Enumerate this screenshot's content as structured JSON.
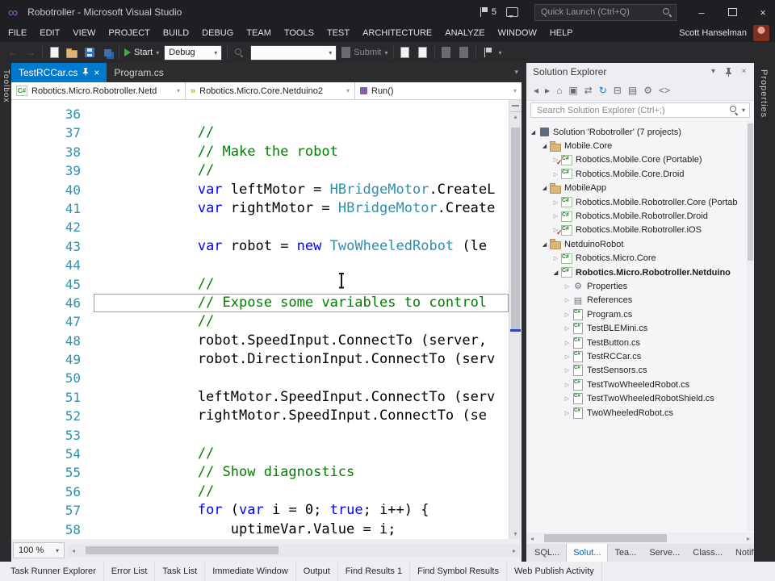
{
  "window": {
    "title": "Robotroller - Microsoft Visual Studio",
    "notification_count": "5",
    "quick_launch_placeholder": "Quick Launch (Ctrl+Q)",
    "user_name": "Scott Hanselman"
  },
  "menus": [
    "FILE",
    "EDIT",
    "VIEW",
    "PROJECT",
    "BUILD",
    "DEBUG",
    "TEAM",
    "TOOLS",
    "TEST",
    "ARCHITECTURE",
    "ANALYZE",
    "WINDOW",
    "HELP"
  ],
  "toolbar": {
    "start_label": "Start",
    "debug_value": "Debug",
    "submit_label": "Submit"
  },
  "side_strips": {
    "left_label": "Toolbox",
    "right_label": "Properties"
  },
  "doc_tabs": [
    {
      "label": "TestRCCar.cs",
      "active": true
    },
    {
      "label": "Program.cs",
      "active": false
    }
  ],
  "navbar": {
    "project": "Robotics.Micro.Robotroller.Netd",
    "type": "Robotics.Micro.Core.Netduino2",
    "member": "Run()"
  },
  "editor": {
    "zoom": "100 %",
    "lines": [
      {
        "n": "36",
        "segs": []
      },
      {
        "n": "37",
        "segs": [
          {
            "t": "            //",
            "c": "com"
          }
        ]
      },
      {
        "n": "38",
        "segs": [
          {
            "t": "            // Make the robot",
            "c": "com"
          }
        ]
      },
      {
        "n": "39",
        "segs": [
          {
            "t": "            //",
            "c": "com"
          }
        ]
      },
      {
        "n": "40",
        "segs": [
          {
            "t": "            ",
            "c": "pln"
          },
          {
            "t": "var",
            "c": "kw"
          },
          {
            "t": " leftMotor = ",
            "c": "pln"
          },
          {
            "t": "HBridgeMotor",
            "c": "typ"
          },
          {
            "t": ".CreateL",
            "c": "pln"
          }
        ]
      },
      {
        "n": "41",
        "segs": [
          {
            "t": "            ",
            "c": "pln"
          },
          {
            "t": "var",
            "c": "kw"
          },
          {
            "t": " rightMotor = ",
            "c": "pln"
          },
          {
            "t": "HBridgeMotor",
            "c": "typ"
          },
          {
            "t": ".Create",
            "c": "pln"
          }
        ]
      },
      {
        "n": "42",
        "segs": []
      },
      {
        "n": "43",
        "segs": [
          {
            "t": "            ",
            "c": "pln"
          },
          {
            "t": "var",
            "c": "kw"
          },
          {
            "t": " robot = ",
            "c": "pln"
          },
          {
            "t": "new",
            "c": "kw"
          },
          {
            "t": " ",
            "c": "pln"
          },
          {
            "t": "TwoWheeledRobot",
            "c": "typ"
          },
          {
            "t": " (le",
            "c": "pln"
          }
        ]
      },
      {
        "n": "44",
        "segs": []
      },
      {
        "n": "45",
        "segs": [
          {
            "t": "            //",
            "c": "com"
          }
        ]
      },
      {
        "n": "46",
        "boxed": true,
        "segs": [
          {
            "t": "            // Expose some variables to control",
            "c": "com"
          }
        ]
      },
      {
        "n": "47",
        "segs": [
          {
            "t": "            //",
            "c": "com"
          }
        ]
      },
      {
        "n": "48",
        "segs": [
          {
            "t": "            robot.SpeedInput.ConnectTo (server,",
            "c": "pln"
          }
        ]
      },
      {
        "n": "49",
        "segs": [
          {
            "t": "            robot.DirectionInput.ConnectTo (serv",
            "c": "pln"
          }
        ]
      },
      {
        "n": "50",
        "segs": []
      },
      {
        "n": "51",
        "segs": [
          {
            "t": "            leftMotor.SpeedInput.ConnectTo (serv",
            "c": "pln"
          }
        ]
      },
      {
        "n": "52",
        "segs": [
          {
            "t": "            rightMotor.SpeedInput.ConnectTo (se",
            "c": "pln"
          }
        ]
      },
      {
        "n": "53",
        "segs": []
      },
      {
        "n": "54",
        "segs": [
          {
            "t": "            //",
            "c": "com"
          }
        ]
      },
      {
        "n": "55",
        "segs": [
          {
            "t": "            // Show diagnostics",
            "c": "com"
          }
        ]
      },
      {
        "n": "56",
        "segs": [
          {
            "t": "            //",
            "c": "com"
          }
        ]
      },
      {
        "n": "57",
        "segs": [
          {
            "t": "            ",
            "c": "pln"
          },
          {
            "t": "for",
            "c": "kw"
          },
          {
            "t": " (",
            "c": "pln"
          },
          {
            "t": "var",
            "c": "kw"
          },
          {
            "t": " i = 0; ",
            "c": "pln"
          },
          {
            "t": "true",
            "c": "kw"
          },
          {
            "t": "; i++) {",
            "c": "pln"
          }
        ]
      },
      {
        "n": "58",
        "segs": [
          {
            "t": "                uptimeVar.Value = i;",
            "c": "pln"
          }
        ]
      }
    ]
  },
  "solution_explorer": {
    "title": "Solution Explorer",
    "search_placeholder": "Search Solution Explorer (Ctrl+;)",
    "toolbar_icons": [
      "back-icon",
      "forward-icon",
      "home-icon",
      "scope-to-this-icon",
      "sync-with-active-document-icon",
      "refresh-icon",
      "collapse-all-icon",
      "show-all-files-icon",
      "properties-icon",
      "view-code-icon"
    ],
    "tree": [
      {
        "indent": 0,
        "arrow": "exp",
        "icon": "solution",
        "label": "Solution 'Robotroller' (7 projects)"
      },
      {
        "indent": 1,
        "arrow": "exp",
        "icon": "folder",
        "label": "Mobile.Core"
      },
      {
        "indent": 2,
        "arrow": "col",
        "icon": "csproj",
        "mark": true,
        "label": "Robotics.Mobile.Core (Portable)"
      },
      {
        "indent": 2,
        "arrow": "col",
        "icon": "csproj",
        "label": "Robotics.Mobile.Core.Droid"
      },
      {
        "indent": 1,
        "arrow": "exp",
        "icon": "folder",
        "label": "MobileApp"
      },
      {
        "indent": 2,
        "arrow": "col",
        "icon": "csproj",
        "label": "Robotics.Mobile.Robotroller.Core (Portab"
      },
      {
        "indent": 2,
        "arrow": "col",
        "icon": "csproj",
        "label": "Robotics.Mobile.Robotroller.Droid"
      },
      {
        "indent": 2,
        "arrow": "col",
        "icon": "csproj",
        "mark": true,
        "label": "Robotics.Mobile.Robotroller.iOS"
      },
      {
        "indent": 1,
        "arrow": "exp",
        "icon": "folder",
        "label": "NetduinoRobot"
      },
      {
        "indent": 2,
        "arrow": "col",
        "icon": "csproj",
        "label": "Robotics.Micro.Core"
      },
      {
        "indent": 2,
        "arrow": "exp",
        "icon": "csproj",
        "bold": true,
        "label": "Robotics.Micro.Robotroller.Netduino"
      },
      {
        "indent": 3,
        "arrow": "col",
        "icon": "props",
        "label": "Properties"
      },
      {
        "indent": 3,
        "arrow": "col",
        "icon": "refs",
        "label": "References"
      },
      {
        "indent": 3,
        "arrow": "col",
        "icon": "csfile",
        "label": "Program.cs"
      },
      {
        "indent": 3,
        "arrow": "col",
        "icon": "csfile",
        "label": "TestBLEMini.cs"
      },
      {
        "indent": 3,
        "arrow": "col",
        "icon": "csfile",
        "label": "TestButton.cs"
      },
      {
        "indent": 3,
        "arrow": "col",
        "icon": "csfile",
        "label": "TestRCCar.cs"
      },
      {
        "indent": 3,
        "arrow": "col",
        "icon": "csfile",
        "label": "TestSensors.cs"
      },
      {
        "indent": 3,
        "arrow": "col",
        "icon": "csfile",
        "label": "TestTwoWheeledRobot.cs"
      },
      {
        "indent": 3,
        "arrow": "col",
        "icon": "csfile",
        "label": "TestTwoWheeledRobotShield.cs"
      },
      {
        "indent": 3,
        "arrow": "col",
        "icon": "csfile",
        "label": "TwoWheeledRobot.cs"
      }
    ],
    "bottom_tabs": [
      {
        "label": "SQL...",
        "active": false
      },
      {
        "label": "Solut...",
        "active": true
      },
      {
        "label": "Tea...",
        "active": false
      },
      {
        "label": "Serve...",
        "active": false
      },
      {
        "label": "Class...",
        "active": false
      },
      {
        "label": "Notif...",
        "active": false
      }
    ]
  },
  "bottom_bar": {
    "tabs": [
      "Task Runner Explorer",
      "Error List",
      "Task List",
      "Immediate Window",
      "Output",
      "Find Results 1",
      "Find Symbol Results",
      "Web Publish Activity"
    ]
  },
  "colors": {
    "accent": "#007acc",
    "keyword": "#0000ff",
    "type": "#2b91af",
    "comment": "#008000"
  }
}
